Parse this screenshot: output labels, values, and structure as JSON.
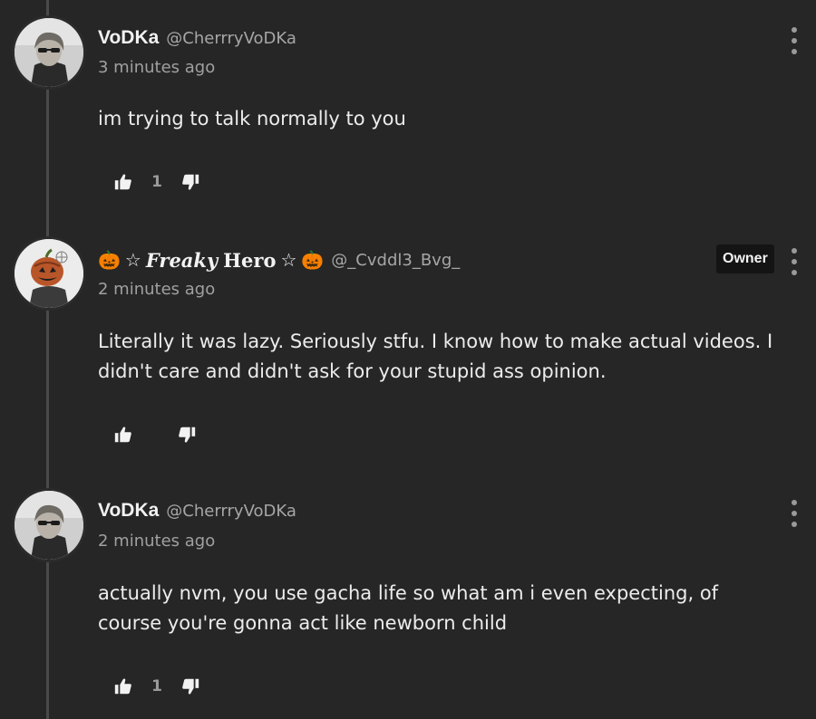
{
  "comments": [
    {
      "name": "VoDKa",
      "handle": "@CherrryVoDKa",
      "time": "3 minutes ago",
      "text": "im trying to talk normally to you",
      "likes": "1",
      "avatar_icon": "user-photo-sunglasses"
    },
    {
      "name_parts": {
        "emoji_left": "🎃",
        "star_left": "☆",
        "fancy": "Freaky",
        "plain": "Hero",
        "star_right": "☆",
        "emoji_right": "🎃"
      },
      "handle": "@_Cvddl3_Bvg_",
      "badge": "Owner",
      "time": "2 minutes ago",
      "text": "Literally it was lazy. Seriously stfu. I know how to make actual videos. I didn't care and didn't ask for your stupid ass opinion.",
      "likes": "",
      "avatar_icon": "pumpkin-head-avatar"
    },
    {
      "name": "VoDKa",
      "handle": "@CherrryVoDKa",
      "time": "2 minutes ago",
      "text": "actually nvm, you use gacha life so what am i even expecting, of course you're gonna act like newborn child",
      "likes": "1",
      "avatar_icon": "user-photo-sunglasses"
    }
  ],
  "icons": {
    "like": "thumbs-up-icon",
    "dislike": "thumbs-down-icon",
    "menu": "more-vertical-icon"
  },
  "colors": {
    "background": "#262626",
    "thread_line": "#4a4a4a",
    "text": "#ececec",
    "muted": "#a0a0a0",
    "badge_bg": "#141414"
  }
}
